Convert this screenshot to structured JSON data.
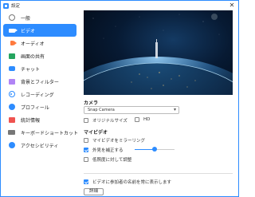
{
  "window": {
    "title": "設定",
    "close_glyph": "✕"
  },
  "sidebar": {
    "items": [
      {
        "label": "一般",
        "icon": "gear-icon",
        "active": false
      },
      {
        "label": "ビデオ",
        "icon": "video-camera-icon",
        "active": true
      },
      {
        "label": "オーディオ",
        "icon": "speaker-icon",
        "active": false
      },
      {
        "label": "画面の共有",
        "icon": "screen-share-icon",
        "active": false
      },
      {
        "label": "チャット",
        "icon": "chat-bubble-icon",
        "active": false
      },
      {
        "label": "背景とフィルター",
        "icon": "background-filter-icon",
        "active": false
      },
      {
        "label": "レコーディング",
        "icon": "record-icon",
        "active": false
      },
      {
        "label": "プロフィール",
        "icon": "profile-icon",
        "active": false
      },
      {
        "label": "統計情報",
        "icon": "statistics-icon",
        "active": false
      },
      {
        "label": "キーボードショートカット",
        "icon": "keyboard-icon",
        "active": false
      },
      {
        "label": "アクセシビリティ",
        "icon": "accessibility-icon",
        "active": false
      }
    ]
  },
  "video": {
    "camera_label": "カメラ",
    "camera_selected": "Snap Camera",
    "aspect": {
      "original_label": "オリジナルサイズ",
      "hd_label": "HD"
    },
    "my_video_label": "マイビデオ",
    "mirror": {
      "label": "マイビデオをミラーリング",
      "checked": false
    },
    "touch_up": {
      "label": "外見を補正する",
      "checked": true,
      "level_percent": 50
    },
    "low_light": {
      "label": "低照度に対して調整",
      "checked": false
    },
    "show_names": {
      "label": "ビデオに参加者の名前を常に表示します",
      "checked": true
    },
    "details_button": "詳細"
  },
  "colors": {
    "accent": "#2d8cff",
    "audio_icon": "#ff7a3d",
    "share_icon": "#25a55f",
    "background_icon": "#b084f5",
    "stats_icon": "#ef5350"
  }
}
